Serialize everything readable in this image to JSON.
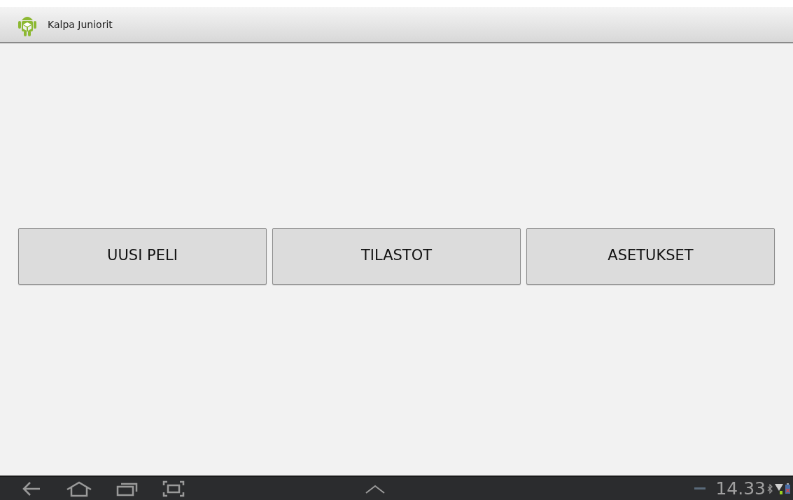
{
  "action_bar": {
    "title": "Kalpa Juniorit"
  },
  "buttons": [
    {
      "label": "UUSI PELI"
    },
    {
      "label": "TILASTOT"
    },
    {
      "label": "ASETUKSET"
    }
  ],
  "system_bar": {
    "time": "14.33"
  }
}
